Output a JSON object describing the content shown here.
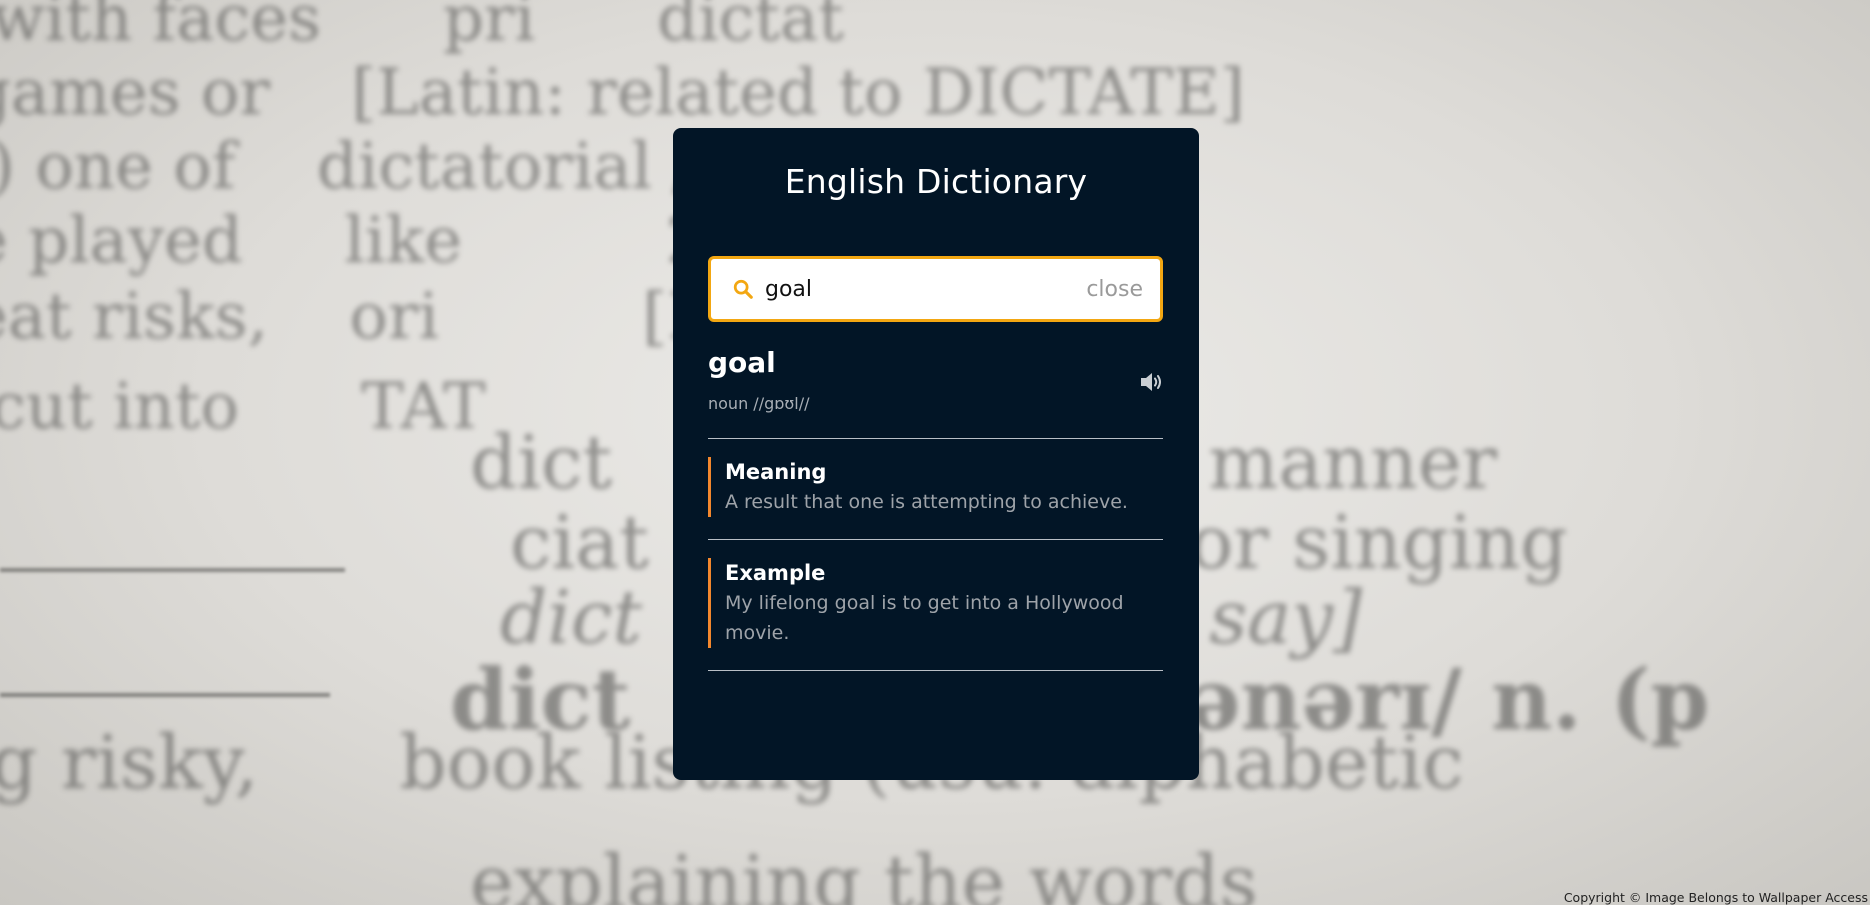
{
  "app": {
    "title": "English Dictionary"
  },
  "search": {
    "icon": "search-icon",
    "value": "goal",
    "close_label": "close"
  },
  "result": {
    "word": "goal",
    "phonetic": "noun //gɒʊl//",
    "audio_icon": "speaker-icon"
  },
  "meaning": {
    "label": "Meaning",
    "text": "A result that one is attempting to achieve."
  },
  "example": {
    "label": "Example",
    "text": "My lifelong goal is to get into a Hollywood movie."
  },
  "footer": {
    "copyright": "Copyright © Image Belongs to Wallpaper Access"
  },
  "colors": {
    "card_bg": "#021526",
    "accent_orange": "#f3a712",
    "section_border": "#f3872d"
  }
}
